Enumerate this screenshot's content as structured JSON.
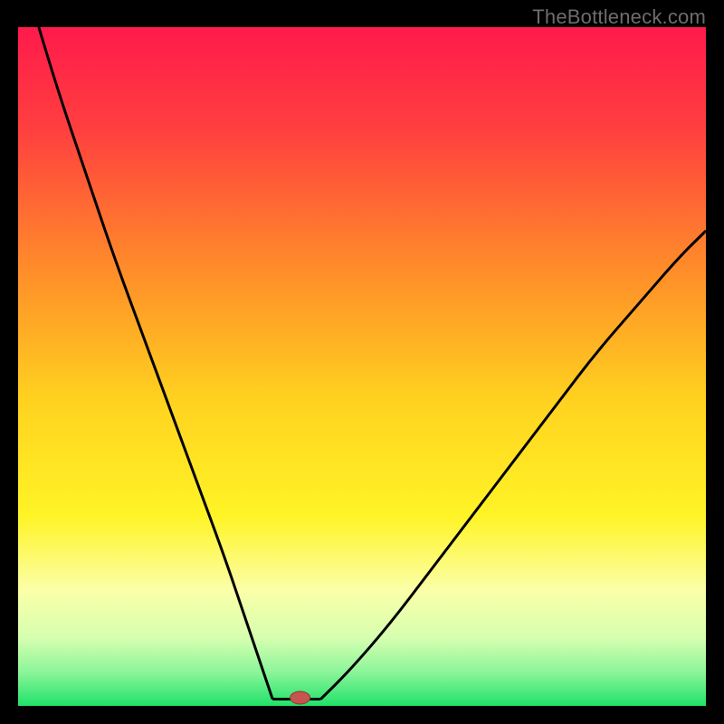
{
  "attribution": "TheBottleneck.com",
  "colors": {
    "frame_bg": "#000000",
    "curve": "#000000",
    "marker_fill": "#c7544e",
    "marker_stroke": "#8d3a36",
    "gradient_stops": [
      {
        "offset": 0.0,
        "color": "#ff1a4b"
      },
      {
        "offset": 0.15,
        "color": "#ff3f3f"
      },
      {
        "offset": 0.35,
        "color": "#ff8a2a"
      },
      {
        "offset": 0.55,
        "color": "#ffd21f"
      },
      {
        "offset": 0.72,
        "color": "#fff426"
      },
      {
        "offset": 0.83,
        "color": "#fbffa8"
      },
      {
        "offset": 0.9,
        "color": "#d6ffb0"
      },
      {
        "offset": 0.95,
        "color": "#8cf59a"
      },
      {
        "offset": 1.0,
        "color": "#20e26a"
      }
    ]
  },
  "chart_data": {
    "type": "line",
    "title": "",
    "xlabel": "",
    "ylabel": "",
    "x_range": [
      0,
      100
    ],
    "y_range": [
      0,
      100
    ],
    "optimum_x": 41,
    "marker": {
      "x": 41,
      "y": 1.2
    },
    "flat_segment": {
      "x_start": 37,
      "x_end": 44,
      "y": 1.0
    },
    "series": [
      {
        "name": "left_branch",
        "x": [
          3,
          6,
          10,
          14,
          18,
          22,
          26,
          30,
          33,
          35,
          37
        ],
        "y": [
          100,
          90,
          78,
          66,
          55,
          44,
          33,
          22,
          13,
          7,
          1
        ]
      },
      {
        "name": "right_branch",
        "x": [
          44,
          48,
          54,
          60,
          66,
          72,
          78,
          84,
          90,
          96,
          100
        ],
        "y": [
          1,
          5,
          12,
          20,
          28,
          36,
          44,
          52,
          59,
          66,
          70
        ]
      }
    ]
  }
}
